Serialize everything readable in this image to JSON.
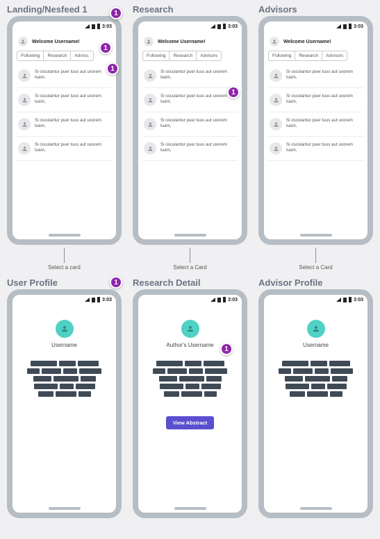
{
  "screens": {
    "landing": {
      "title": "Landing/Nesfeed 1"
    },
    "research": {
      "title": "Research"
    },
    "advisors": {
      "title": "Advisors"
    },
    "user_profile": {
      "title": "User Profile"
    },
    "research_detail": {
      "title": "Research Detail"
    },
    "advisor_profile": {
      "title": "Advisor Profile"
    }
  },
  "statusbar": {
    "time": "3:03"
  },
  "welcome": "Welcome Username!",
  "tabs": {
    "following": "Following",
    "research": "Research",
    "advisors": "Advisors",
    "advisors_truncated": "Adviso."
  },
  "card_text": "Si osculantur puer tuus aut uxorem tuam,",
  "connectors": {
    "landing": "Select a card",
    "research": "Select a Card",
    "advisors": "Select a Card"
  },
  "profile": {
    "username": "Username",
    "author_username": "Author's Username"
  },
  "buttons": {
    "view_abstract": "View Abstract"
  },
  "annotations": {
    "landing_title": "1",
    "landing_welcome": "1",
    "landing_tabs": "1",
    "research_card": "1",
    "user_profile_title": "1",
    "research_detail_author": "1"
  }
}
